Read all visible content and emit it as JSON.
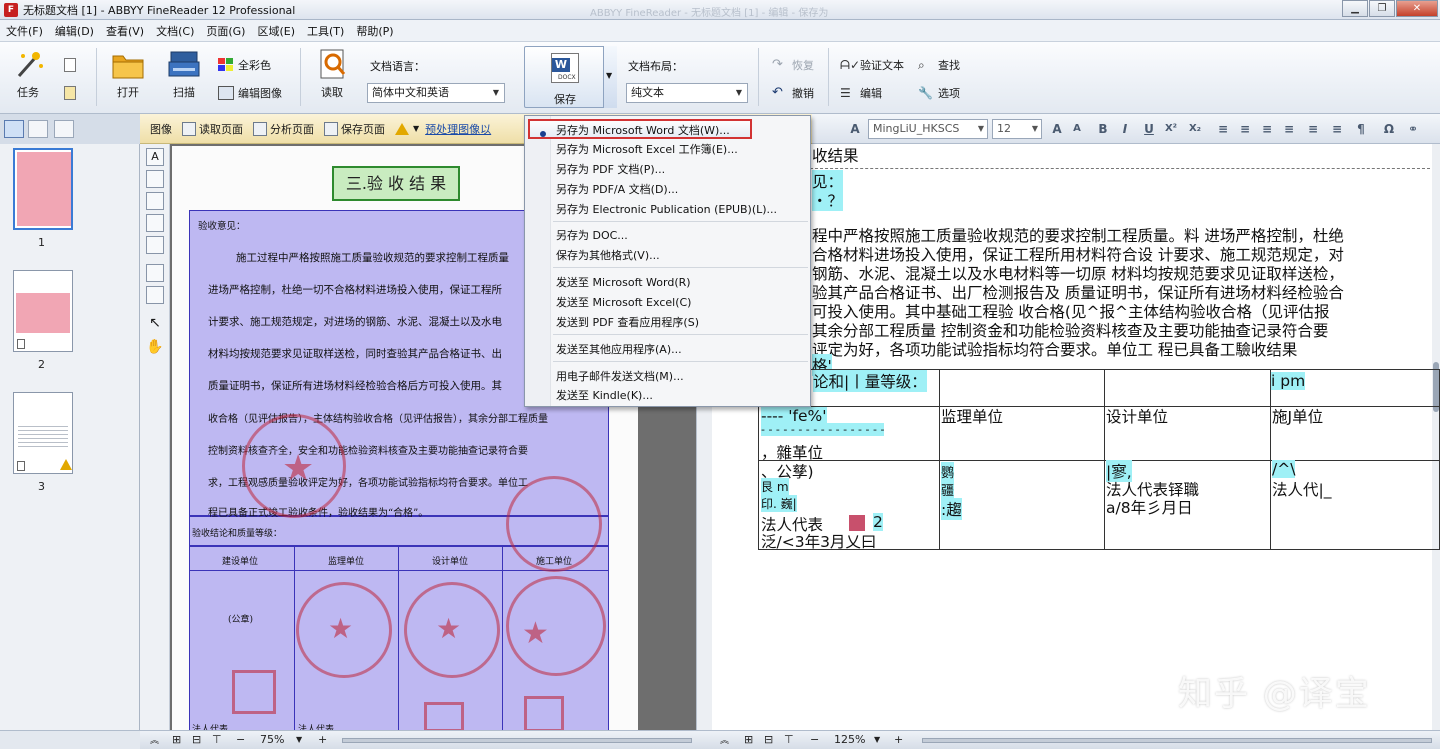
{
  "window": {
    "title": "无标题文档 [1] - ABBYY FineReader 12 Professional",
    "faint_title": "ABBYY FineReader - 无标题文档 [1] - 编辑 - 保存为",
    "buttons": [
      "▁",
      "❐",
      "✕"
    ]
  },
  "menu": [
    "文件(F)",
    "编辑(D)",
    "查看(V)",
    "文档(C)",
    "页面(G)",
    "区域(E)",
    "工具(T)",
    "帮助(P)"
  ],
  "toolbar": {
    "task": "任务",
    "open": "打开",
    "scan": "扫描",
    "full_color": "全彩色",
    "edit_image": "编辑图像",
    "read": "读取",
    "doc_language_label": "文档语言：",
    "doc_language_value": "简体中文和英语",
    "save": "保存",
    "save_icon_text": "W",
    "save_icon_sub": "DOCX",
    "doc_layout_label": "文档布局：",
    "doc_layout_value": "纯文本",
    "redo": "恢复",
    "undo": "撤销",
    "verify_text": "验证文本",
    "edit": "编辑",
    "find": "查找",
    "options": "选项"
  },
  "image_bar": {
    "image": "图像",
    "read_page": "读取页面",
    "analyze_page": "分析页面",
    "save_page": "保存页面",
    "preprocess": "预处理图像以"
  },
  "format_bar": {
    "font": "MingLiU_HKSCS",
    "size": "12",
    "buttons": [
      "A",
      "A",
      "B",
      "I",
      "U",
      "X²",
      "X₂",
      "≡",
      "≡",
      "≡",
      "≡",
      "≡",
      "≡",
      "¶",
      "Ω",
      "⚭"
    ]
  },
  "pages": [
    {
      "num": "1",
      "selected": true
    },
    {
      "num": "2",
      "selected": false
    },
    {
      "num": "3",
      "selected": false,
      "warning": true
    }
  ],
  "scan": {
    "title": "三.验 收 结 果",
    "opinion": "验收意见：",
    "lines": [
      "施工过程中严格按照施工质量验收规范的要求控制工程质量",
      "进场严格控制，杜绝一切不合格材料进场投入使用，保证工程所",
      "计要求、施工规范规定，对进场的钢筋、水泥、混凝土以及水电",
      "材料均按规范要求见证取样送检，同时查验其产品合格证书、出",
      "质量证明书，保证所有进场材料经检验合格后方可投入使用。其",
      "收合格（见评估报告），主体结构验收合格（见评估报告），其余分部工程质量",
      "控制资料核查齐全，安全和功能检验资料核查及主要功能抽查记录符合要",
      "求，工程观感质量验收评定为好，各项功能试验指标均符合要求。单位工",
      "程已具备正式竣工验收条件，验收结果为“合格”。"
    ],
    "conclusion": "验收结论和质量等级：",
    "headers": [
      "建设单位",
      "监理单位",
      "设计单位",
      "施工单位"
    ],
    "seal": "(公章)",
    "rep": "法人代表"
  },
  "ocr": {
    "lines": [
      "收结果",
      "见：",
      "・？",
      "程中严格按照施工质量验收规范的要求控制工程质量。料  进场严格控制，杜绝",
      "合格材料进场投入使用，保证工程所用材料符合设  计要求、施工规范规定，对",
      "钢筋、水泥、混凝土以及水电材料等一切原  材料均按规范要求见证取样送检，",
      "验其产品合格证书、出厂检测报告及  质量证明书，保证所有进场材料经检验合",
      "可投入使用。其中基础工程验  收合格(见^报^主体结构验收合格（见评估报",
      "其余分部工程质量  控制资金和功能检验资料核查及主要功能抽查记录符合要",
      "评定为好，各项功能试验指标均符合要求。单位工  程已具备工驗收结果",
      "格'"
    ],
    "table": {
      "r1c1": "论和|丨量等级：",
      "r1c4": "i pm",
      "r2c1a": "----  'fe%'",
      "r2c1b": "- - - - - - - - - - - - - - - - -",
      "r2c1c": "，雜革位",
      "r2c2": "监理单位",
      "r2c3": "设计单位",
      "r2c4": "施J单位",
      "r3c1a": "、公孳)",
      "r3c1b": "艮  m",
      "r3c1c": "印. 巍|",
      "r3c1d": "法人代表",
      "r3c1e": "2",
      "r3c1f": "泛/<3年3月乂曰",
      "r3c2a": "鹦",
      "r3c2b": "疆",
      "r3c2c": ":趨",
      "r3c3a": "|寥,",
      "r3c3b": "法人代表铎職",
      "r3c3c": "a/8年彡月日",
      "r3c4a": "/^\\",
      "r3c4b": "法人代|_"
    }
  },
  "save_menu": {
    "items": [
      "另存为 Microsoft Word 文档(W)...",
      "另存为 Microsoft Excel 工作簿(E)...",
      "另存为 PDF 文档(P)...",
      "另存为 PDF/A 文档(D)...",
      "另存为 Electronic Publication (EPUB)(L)...",
      "另存为 DOC...",
      "保存为其他格式(V)...",
      "发送至 Microsoft Word(R)",
      "发送至 Microsoft Excel(C)",
      "发送到 PDF 查看应用程序(S)",
      "发送至其他应用程序(A)...",
      "用电子邮件发送文档(M)...",
      "发送至 Kindle(K)..."
    ]
  },
  "status": {
    "zoom_left": "75%",
    "zoom_right": "125%",
    "minus": "−",
    "plus": "+"
  },
  "watermark": "知乎 @译宝",
  "colors": {
    "highlight": "#9ff0f6",
    "scan_overlay": "#8c82eb",
    "menu_border": "#d23333"
  }
}
